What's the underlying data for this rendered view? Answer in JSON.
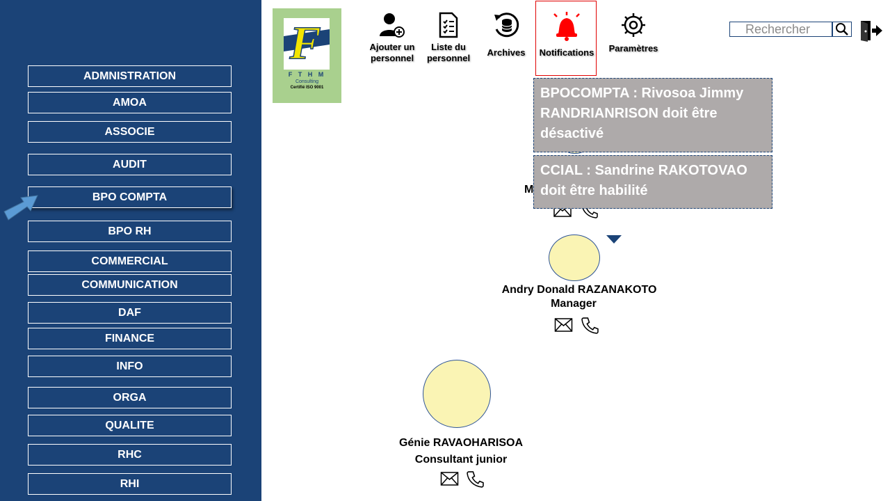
{
  "sidebar": {
    "departments": [
      "ADMNISTRATION",
      "AMOA",
      "ASSOCIE",
      "AUDIT",
      "BPO COMPTA",
      "BPO RH",
      "COMMERCIAL",
      "COMMUNICATION",
      "DAF",
      "FINANCE",
      "INFO",
      "ORGA",
      "QUALITE",
      "RHC",
      "RHI"
    ],
    "active_department": "BPO COMPTA"
  },
  "logo": {
    "letter": "F",
    "brand": "F T H M",
    "sub": "Consulting",
    "cert": "Certifié ISO 9001"
  },
  "toolbar": {
    "add_person": [
      "Ajouter un",
      "personnel"
    ],
    "staff_list": [
      "Liste du",
      "personnel"
    ],
    "archives": "Archives",
    "notifications": "Notifications",
    "settings": "Paramètres"
  },
  "search": {
    "placeholder": "Rechercher"
  },
  "notifications": [
    "BPOCOMPTA : Rivosoa Jimmy RANDRIANRISON doit être désactivé",
    "CCIAL : Sandrine RAKOTOVAO doit être habilité"
  ],
  "org": {
    "partial_name_fragment": "M",
    "manager": {
      "name": "Andry Donald RAZANAKOTO",
      "role": "Manager"
    },
    "consultant": {
      "name": "Génie RAVAOHARISOA",
      "role": "Consultant junior"
    }
  },
  "colors": {
    "sidebar": "#1b4377",
    "logo_bg": "#a9d08e",
    "alert": "#e00000",
    "popup": "#aeaaaa",
    "avatar": "#faf4b4"
  }
}
